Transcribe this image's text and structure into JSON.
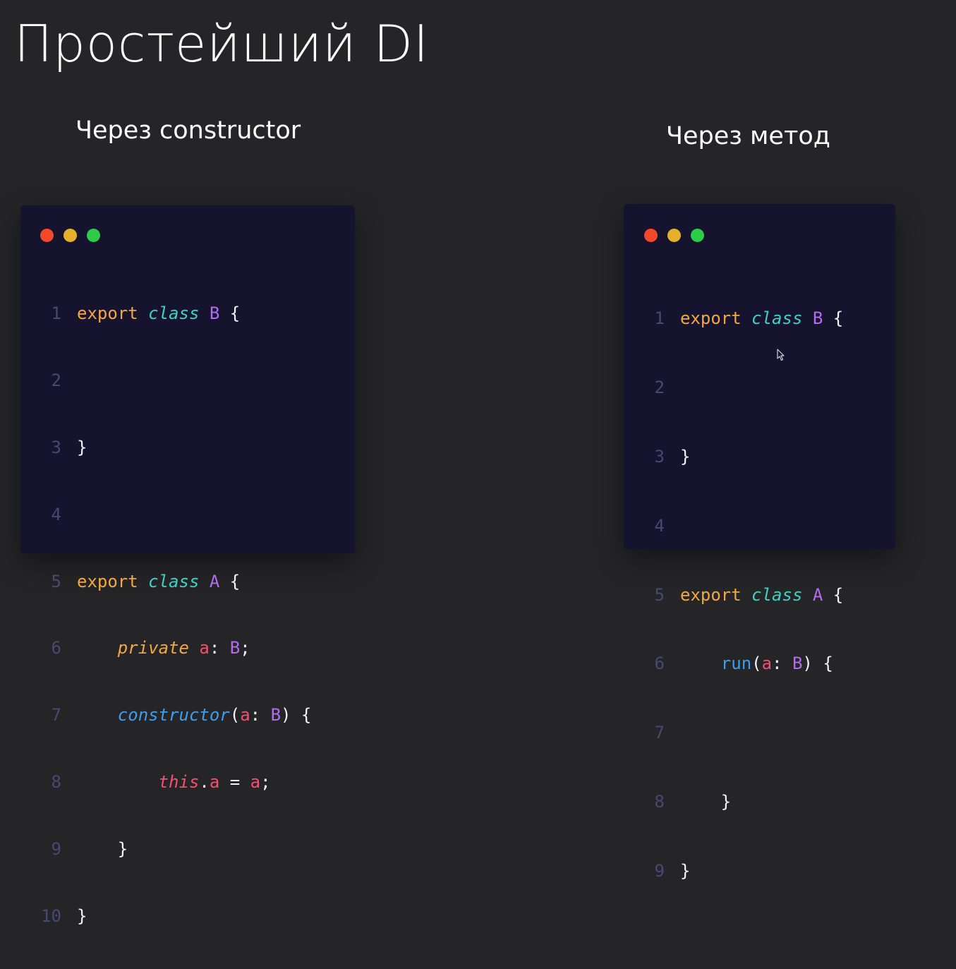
{
  "slide": {
    "title": "Простейший DI",
    "left_subtitle": "Через constructor",
    "right_subtitle": "Через метод"
  },
  "colors": {
    "background": "#252528",
    "code_background": "#15132d",
    "keyword": "#f3a742",
    "class_keyword": "#3fd0c3",
    "type": "#b36bf0",
    "variable": "#f2506f",
    "function": "#3f9dea",
    "line_number": "#4a4770",
    "dot_red": "#f4482b",
    "dot_yellow": "#e6b02a",
    "dot_green": "#2ecb46"
  },
  "left_code": {
    "line_numbers": [
      "1",
      "2",
      "3",
      "4",
      "5",
      "6",
      "7",
      "8",
      "9",
      "10"
    ],
    "l1": {
      "export": "export",
      "class": "class",
      "name": "B",
      "brace": "{"
    },
    "l3": {
      "brace": "}"
    },
    "l5": {
      "export": "export",
      "class": "class",
      "name": "A",
      "brace": "{"
    },
    "l6": {
      "indent": "    ",
      "private": "private",
      "var": "a",
      "colon": ": ",
      "type": "B",
      "semi": ";"
    },
    "l7": {
      "indent": "    ",
      "fn": "constructor",
      "open": "(",
      "var": "a",
      "colon": ": ",
      "type": "B",
      "close": ") {"
    },
    "l8": {
      "indent": "        ",
      "this": "this",
      "dot": ".",
      "var": "a",
      "eq": " = ",
      "var2": "a",
      "semi": ";"
    },
    "l9": {
      "indent": "    ",
      "brace": "}"
    },
    "l10": {
      "brace": "}"
    }
  },
  "right_code": {
    "line_numbers": [
      "1",
      "2",
      "3",
      "4",
      "5",
      "6",
      "7",
      "8",
      "9"
    ],
    "l1": {
      "export": "export",
      "class": "class",
      "name": "B",
      "brace": "{"
    },
    "l3": {
      "brace": "}"
    },
    "l5": {
      "export": "export",
      "class": "class",
      "name": "A",
      "brace": "{"
    },
    "l6": {
      "indent": "    ",
      "fn": "run",
      "open": "(",
      "var": "a",
      "colon": ": ",
      "type": "B",
      "close": ") {"
    },
    "l8": {
      "indent": "    ",
      "brace": "}"
    },
    "l9": {
      "brace": "}"
    }
  }
}
